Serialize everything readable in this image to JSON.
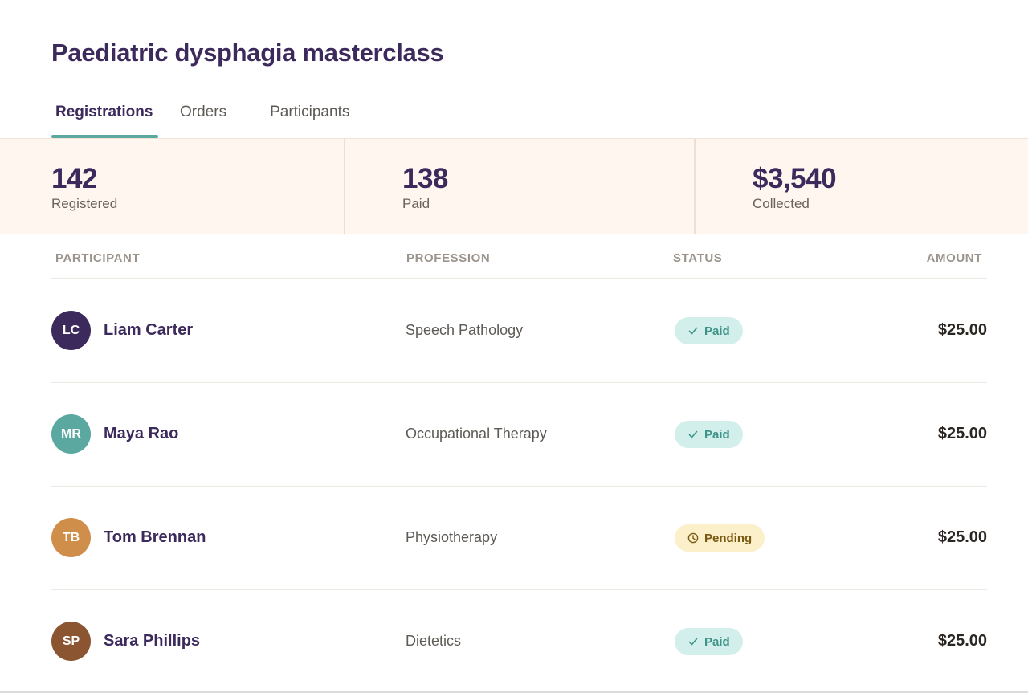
{
  "page": {
    "title": "Paediatric dysphagia masterclass"
  },
  "tabs": [
    {
      "label": "Registrations",
      "active": true
    },
    {
      "label": "Orders",
      "active": false
    },
    {
      "label": "Participants",
      "active": false
    }
  ],
  "stats": [
    {
      "value": "142",
      "label": "Registered"
    },
    {
      "value": "138",
      "label": "Paid"
    },
    {
      "value": "$3,540",
      "label": "Collected"
    }
  ],
  "table": {
    "headers": {
      "participant": "PARTICIPANT",
      "profession": "PROFESSION",
      "status": "STATUS",
      "amount": "AMOUNT"
    },
    "rows": [
      {
        "initials": "LC",
        "name": "Liam Carter",
        "profession": "Speech Pathology",
        "status": "Paid",
        "status_icon": "check-icon",
        "amount": "$25.00",
        "avatar_color": "#3d2a5c"
      },
      {
        "initials": "MR",
        "name": "Maya Rao",
        "profession": "Occupational Therapy",
        "status": "Paid",
        "status_icon": "check-icon",
        "amount": "$25.00",
        "avatar_color": "#5aa8a0"
      },
      {
        "initials": "TB",
        "name": "Tom Brennan",
        "profession": "Physiotherapy",
        "status": "Pending",
        "status_icon": "clock-icon",
        "amount": "$25.00",
        "avatar_color": "#cf8f4b"
      },
      {
        "initials": "SP",
        "name": "Sara Phillips",
        "profession": "Dietetics",
        "status": "Paid",
        "status_icon": "check-icon",
        "amount": "$25.00",
        "avatar_color": "#8a5530"
      }
    ]
  },
  "colors": {
    "accent": "#5aa8a0",
    "primary_text": "#3d2a5c",
    "stats_bg": "#fef6ef",
    "paid_bg": "#d3efeb",
    "pending_bg": "#fbf0c9"
  }
}
